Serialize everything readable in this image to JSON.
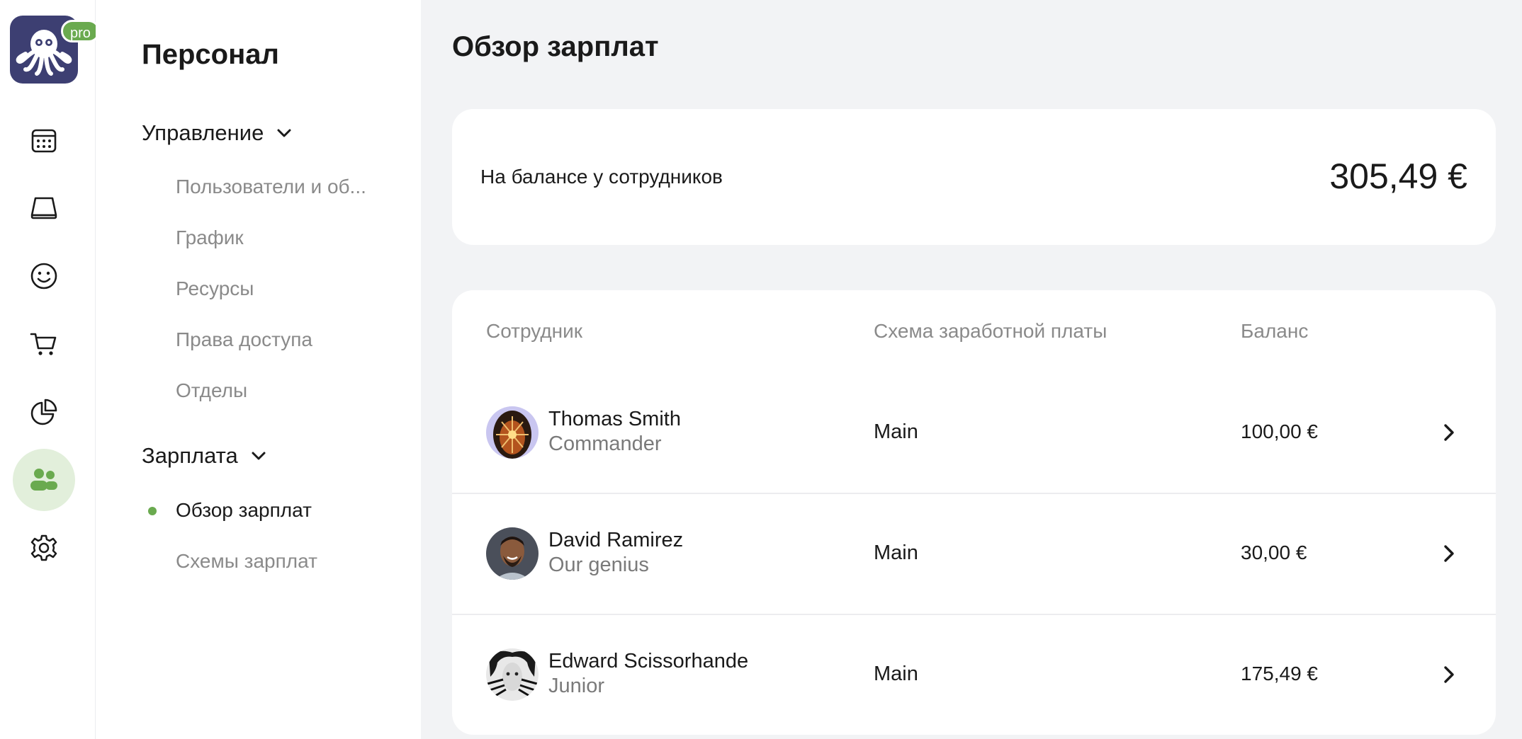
{
  "app": {
    "logo_badge": "pro",
    "accent_color": "#6aaa4f",
    "logo_bg": "#3d3f72"
  },
  "rail": {
    "items": [
      {
        "icon": "calendar-icon"
      },
      {
        "icon": "screen-icon"
      },
      {
        "icon": "smiley-icon"
      },
      {
        "icon": "cart-icon"
      },
      {
        "icon": "pie-chart-icon"
      },
      {
        "icon": "people-icon",
        "active": true
      },
      {
        "icon": "gear-icon"
      }
    ]
  },
  "subnav": {
    "title": "Персонал",
    "groups": [
      {
        "label": "Управление",
        "items": [
          {
            "label": "Пользователи и об..."
          },
          {
            "label": "График"
          },
          {
            "label": "Ресурсы"
          },
          {
            "label": "Права доступа"
          },
          {
            "label": "Отделы"
          }
        ]
      },
      {
        "label": "Зарплата",
        "items": [
          {
            "label": "Обзор зарплат",
            "active": true
          },
          {
            "label": "Схемы зарплат"
          }
        ]
      }
    ]
  },
  "main": {
    "title": "Обзор зарплат",
    "balance": {
      "label": "На балансе у сотрудников",
      "value": "305,49 €"
    },
    "table": {
      "columns": [
        "Сотрудник",
        "Схема заработной платы",
        "Баланс"
      ],
      "rows": [
        {
          "name": "Thomas Smith",
          "role": "Commander",
          "scheme": "Main",
          "balance": "100,00 €"
        },
        {
          "name": "David Ramirez",
          "role": "Our genius",
          "scheme": "Main",
          "balance": "30,00 €"
        },
        {
          "name": "Edward Scissorhande",
          "role": "Junior",
          "scheme": "Main",
          "balance": "175,49 €"
        }
      ]
    }
  }
}
